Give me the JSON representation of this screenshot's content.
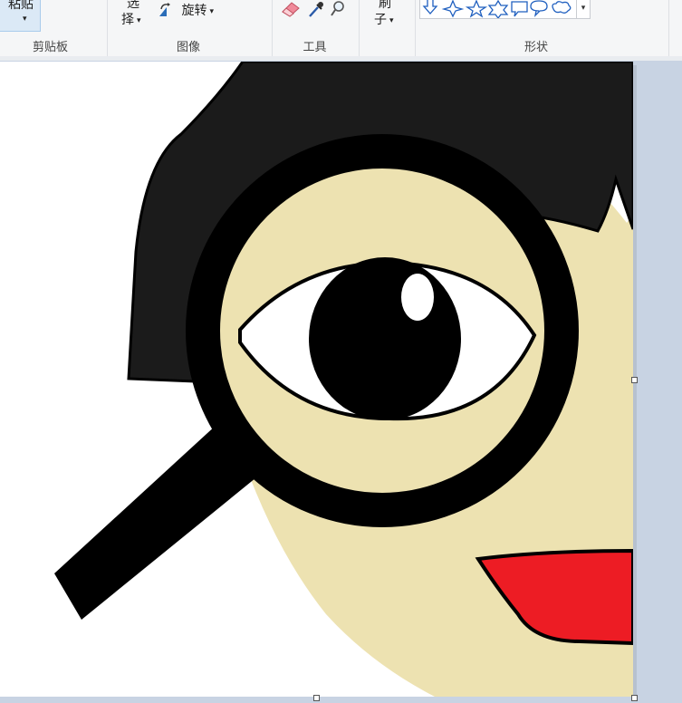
{
  "ribbon": {
    "clipboard": {
      "paste_label": "粘贴",
      "group_label": "剪贴板"
    },
    "image": {
      "select_line1": "选",
      "select_line2": "择",
      "rotate_label": "旋转",
      "group_label": "图像"
    },
    "tools": {
      "group_label": "工具"
    },
    "brushes": {
      "line1": "刷",
      "line2": "子"
    },
    "shapes": {
      "group_label": "形状"
    }
  },
  "canvas": {
    "colors": {
      "hair": "#1b1b1b",
      "skin": "#ede2b1",
      "lips": "#ed1c24",
      "magnifier": "#000000",
      "eye_white": "#ffffff"
    }
  }
}
